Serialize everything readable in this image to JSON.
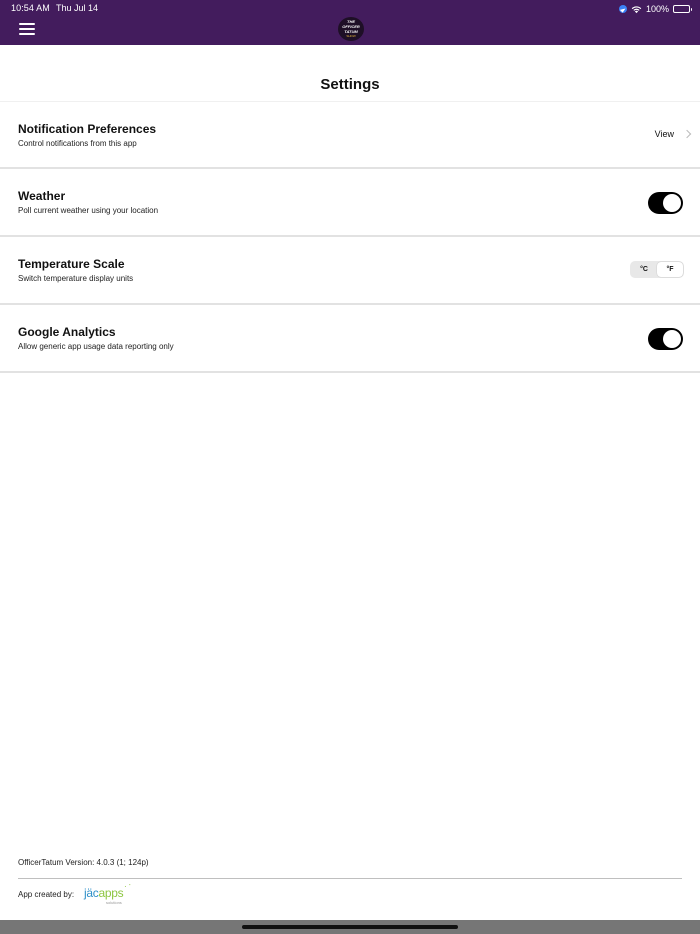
{
  "status_bar": {
    "time": "10:54 AM",
    "date": "Thu Jul 14",
    "battery": "100%"
  },
  "header": {
    "logo_line1": "THE",
    "logo_line2": "OFFICER TATUM",
    "logo_line3": "SHOW"
  },
  "page": {
    "title": "Settings"
  },
  "settings": [
    {
      "title": "Notification Preferences",
      "subtitle": "Control notifications from this app",
      "action_label": "View"
    },
    {
      "title": "Weather",
      "subtitle": "Poll current weather using your location",
      "toggle_on": true
    },
    {
      "title": "Temperature Scale",
      "subtitle": "Switch temperature display units",
      "options": [
        "°C",
        "°F"
      ],
      "selected": "°F"
    },
    {
      "title": "Google Analytics",
      "subtitle": "Allow generic app usage data reporting only",
      "toggle_on": true
    }
  ],
  "footer": {
    "version": "OfficerTatum Version: 4.0.3 (1; 124p)",
    "created_by": "App created by:",
    "brand_jac": "jäc",
    "brand_apps": "apps",
    "brand_sub": "solutions"
  },
  "colors": {
    "header_bg": "#431c5d",
    "toggle_on": "#000000",
    "bottom_bar": "#767676"
  }
}
